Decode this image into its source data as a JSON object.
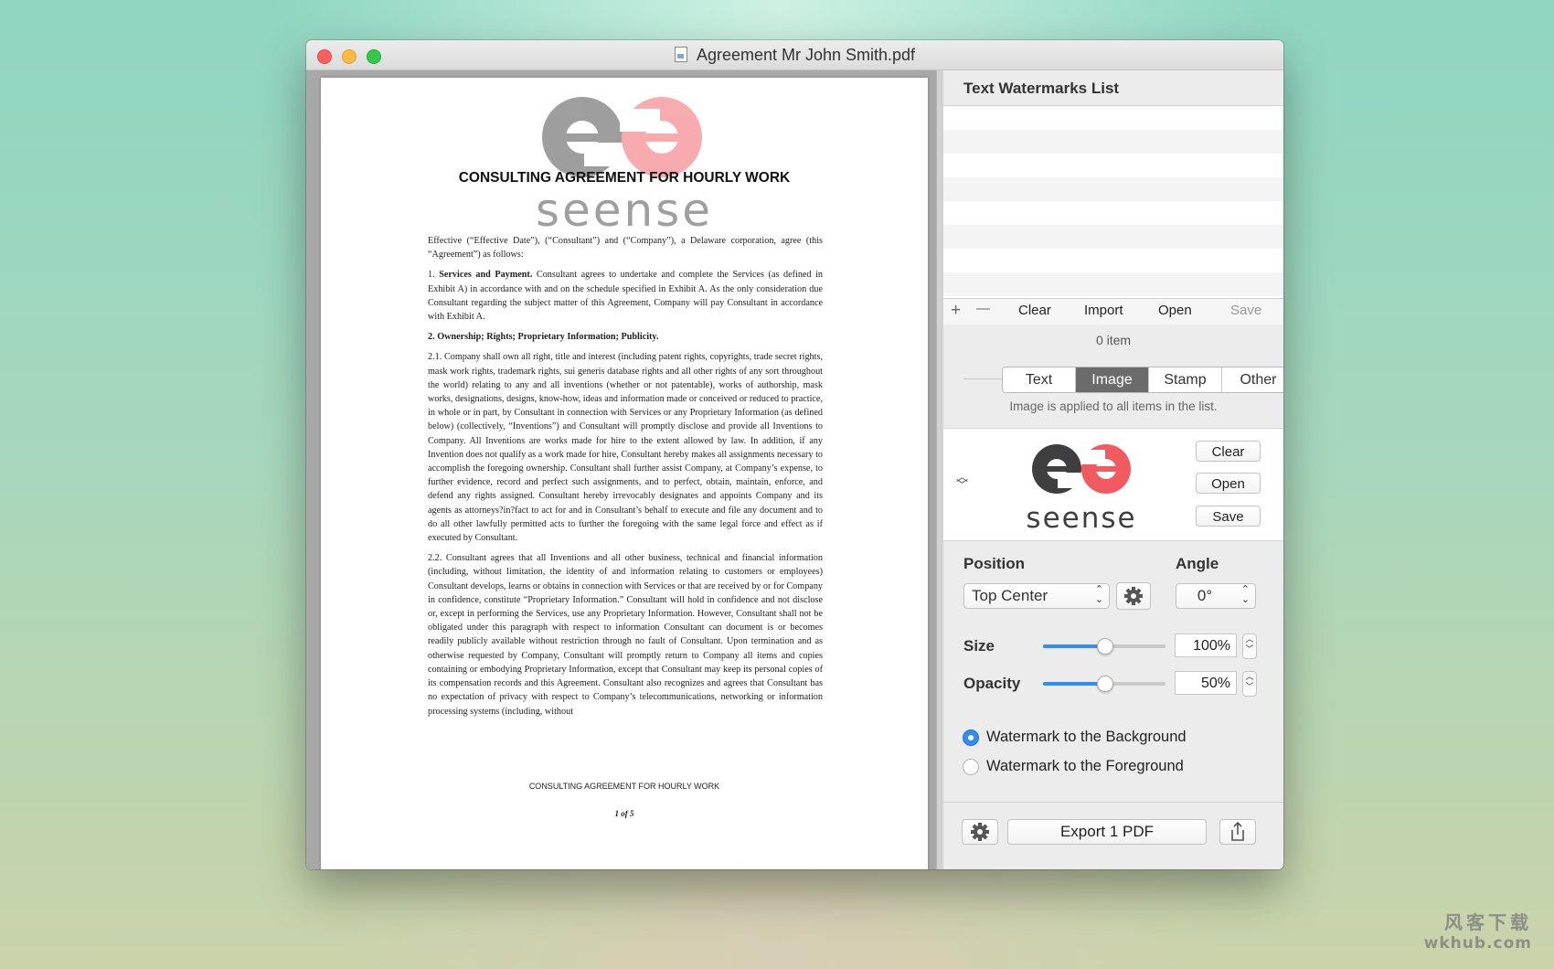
{
  "window": {
    "title": "Agreement Mr John Smith.pdf"
  },
  "document": {
    "watermark_text": "seense",
    "heading": "CONSULTING AGREEMENT FOR HOURLY WORK",
    "paragraphs": [
      "Effective (“Effective Date”), (“Consultant”) and (“Company”), a Delaware corporation, agree (this “Agreement”) as follows:",
      "Consultant agrees to undertake and complete the Services (as defined in Exhibit A) in accordance with and on the schedule specified in Exhibit A. As the only consideration due Consultant regarding the subject matter of this Agreement, Company will pay Consultant in accordance with Exhibit A.",
      "2.1. Company shall own all right, title and interest (including patent rights, copyrights, trade secret rights, mask work rights, trademark rights, sui generis database rights and all other rights of any sort throughout the world) relating to any and all inventions (whether or not patentable), works of authorship, mask works, designations, designs, know-how, ideas and information made or conceived or reduced to practice, in whole or in part, by Consultant in connection with Services or any Proprietary Information (as defined below) (collectively, “Inventions”) and Consultant will promptly disclose and provide all Inventions to Company. All Inventions are works made for hire to the extent allowed by law. In addition, if any Invention does not qualify as a work made for hire, Consultant hereby makes all assignments necessary to accomplish the foregoing ownership. Consultant shall further assist Company, at Company’s expense, to further evidence, record and perfect such assignments, and to perfect, obtain, maintain, enforce, and defend any rights assigned. Consultant hereby irrevocably designates and appoints Company and its agents as attorneys?in?fact to act for and in Consultant’s behalf to execute and file any document and to do all other lawfully permitted acts to further the foregoing with the same legal force and effect as if executed by Consultant.",
      "2.2. Consultant agrees that all Inventions and all other business, technical and financial information (including, without limitation, the identity of and information relating to customers or employees) Consultant develops, learns or obtains in connection with Services or that are received by or for Company in confidence, constitute “Proprietary Information.” Consultant will hold in confidence and not disclose or, except in performing the Services, use any Proprietary Information. However, Consultant shall not be obligated under this paragraph with respect to information Consultant can document is or becomes readily publicly available without restriction through no fault of Consultant. Upon termination and as otherwise requested by Company, Consultant will promptly return to Company all items and copies containing or embodying Proprietary Information, except that Consultant may keep its personal copies of its compensation records and this Agreement. Consultant also recognizes and agrees that Consultant has no expectation of privacy with respect to Company’s telecommunications, networking or information processing systems (including, without"
    ],
    "section1_prefix": "1.",
    "section1_heading": "Services and Payment.",
    "section2_heading": "2. Ownership; Rights; Proprietary Information; Publicity.",
    "footer": "CONSULTING AGREEMENT FOR HOURLY WORK",
    "page_number": "1 of 5"
  },
  "sidebar": {
    "list_title": "Text Watermarks List",
    "list_rows": 0,
    "tools": {
      "add": "+",
      "remove": "—",
      "clear": "Clear",
      "import": "Import",
      "open": "Open",
      "save": "Save"
    },
    "count": "0 item",
    "tabs": [
      {
        "label": "Text",
        "selected": false
      },
      {
        "label": "Image",
        "selected": true
      },
      {
        "label": "Stamp",
        "selected": false
      },
      {
        "label": "Other",
        "selected": false
      }
    ],
    "tab_note": "Image is applied to all items in the list.",
    "image_buttons": {
      "clear": "Clear",
      "open": "Open",
      "save": "Save"
    },
    "logo_text": "seense",
    "position_label": "Position",
    "position_value": "Top Center",
    "angle_label": "Angle",
    "angle_value": "0°",
    "size_label": "Size",
    "size_value": "100%",
    "size_slider_fraction": 0.5,
    "opacity_label": "Opacity",
    "opacity_value": "50%",
    "opacity_slider_fraction": 0.5,
    "radio_background": "Watermark to the Background",
    "radio_foreground": "Watermark to the Foreground",
    "selected_layer": "background",
    "export_label": "Export 1 PDF"
  },
  "colors": {
    "accent": "#2f8ef5",
    "logo_dark": "#3f3f3f",
    "logo_red": "#f05a60"
  },
  "site_watermark": {
    "cn": "风客下载",
    "en": "wkhub.com"
  }
}
